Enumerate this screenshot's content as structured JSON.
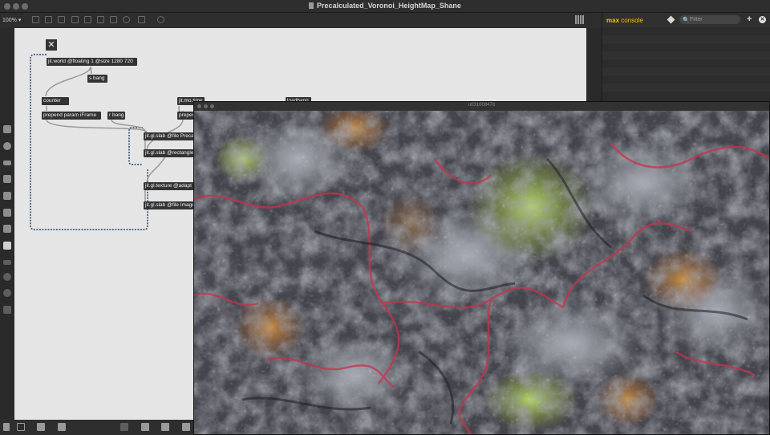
{
  "window": {
    "title": "Precalculated_Voronoi_HeightMap_Shane"
  },
  "toolbar": {
    "zoom": "100%"
  },
  "patcher": {
    "objects": [
      {
        "id": "world",
        "text": "jit.world @floating 1 @size 1280 720"
      },
      {
        "id": "sbang",
        "text": "s bang"
      },
      {
        "id": "counter",
        "text": "counter"
      },
      {
        "id": "prepend1",
        "text": "prepend param iFrame"
      },
      {
        "id": "rbang",
        "text": "r bang"
      },
      {
        "id": "mo",
        "text": "jit.mo.time"
      },
      {
        "id": "prepend2",
        "text": "prepend"
      },
      {
        "id": "loadbang",
        "text": "loadbang"
      },
      {
        "id": "slab1",
        "text": "jit.gl.slab @file Precalculated"
      },
      {
        "id": "slab2",
        "text": "jit.gl.slab @rectangle"
      },
      {
        "id": "texture",
        "text": "jit.gl.texture @adapt"
      },
      {
        "id": "slab3",
        "text": "jit.gl.slab @file Image"
      }
    ]
  },
  "console": {
    "title_max": "max",
    "title_rest": "console",
    "filter_placeholder": "Filter"
  },
  "render_window": {
    "title": "u031008476"
  }
}
